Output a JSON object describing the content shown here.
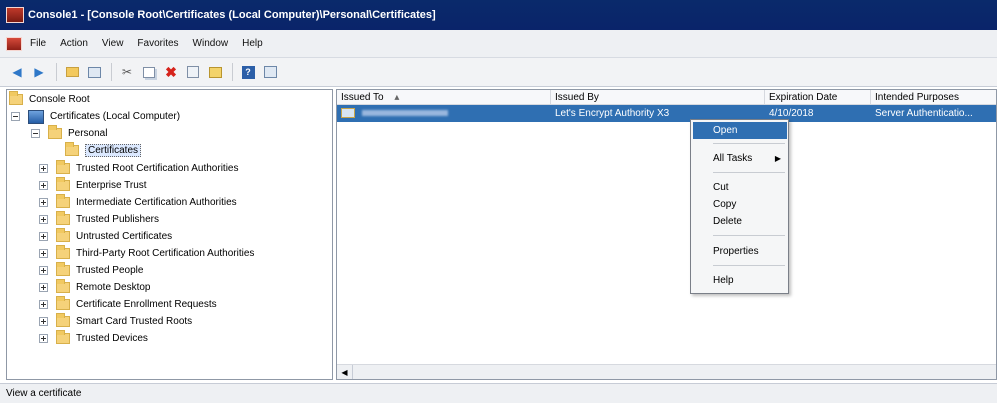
{
  "window": {
    "title": "Console1 - [Console Root\\Certificates (Local Computer)\\Personal\\Certificates]"
  },
  "menu": [
    "File",
    "Action",
    "View",
    "Favorites",
    "Window",
    "Help"
  ],
  "toolbar": {
    "buttons": [
      "back-icon",
      "forward-icon",
      "up-folder-icon",
      "show-hide-tree-icon",
      "cut-icon",
      "copy-icon",
      "delete-icon",
      "properties-icon",
      "export-icon",
      "help-icon",
      "console-icon"
    ]
  },
  "tree": {
    "root": "Console Root",
    "computer": "Certificates (Local Computer)",
    "personal": "Personal",
    "certificates": "Certificates",
    "stores": [
      "Trusted Root Certification Authorities",
      "Enterprise Trust",
      "Intermediate Certification Authorities",
      "Trusted Publishers",
      "Untrusted Certificates",
      "Third-Party Root Certification Authorities",
      "Trusted People",
      "Remote Desktop",
      "Certificate Enrollment Requests",
      "Smart Card Trusted Roots",
      "Trusted Devices"
    ]
  },
  "list": {
    "columns": {
      "issued_to": "Issued To",
      "issued_by": "Issued By",
      "expiration": "Expiration Date",
      "purposes": "Intended Purposes"
    },
    "sort_indicator": "▴",
    "row": {
      "issued_by": "Let's Encrypt Authority X3",
      "expiration": "4/10/2018",
      "purposes": "Server Authenticatio..."
    }
  },
  "context_menu": {
    "open": "Open",
    "all_tasks": "All Tasks",
    "cut": "Cut",
    "copy": "Copy",
    "delete": "Delete",
    "properties": "Properties",
    "help": "Help"
  },
  "status": "View a certificate",
  "colors": {
    "titlebar": "#0a246a",
    "selection": "#2f6fb2",
    "delete_icon": "#d6231b"
  }
}
